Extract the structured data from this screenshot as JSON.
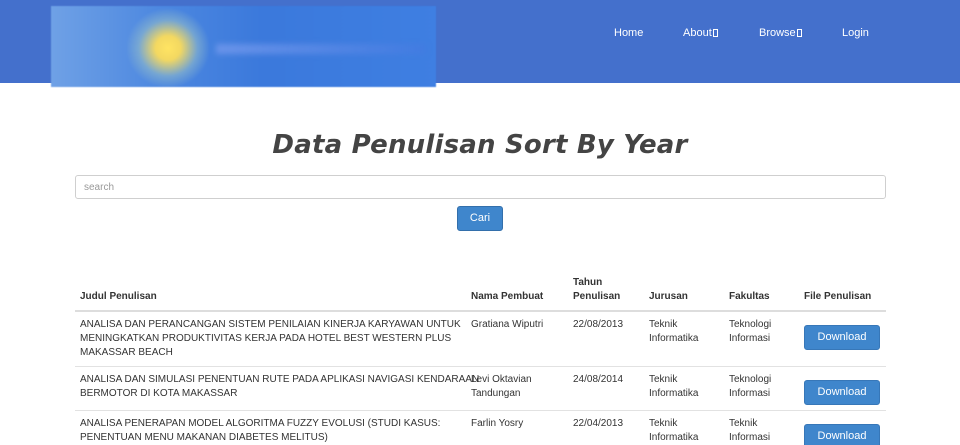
{
  "nav": {
    "home": "Home",
    "about": "About",
    "browse": "Browse",
    "login": "Login"
  },
  "page": {
    "title": "Data Penulisan Sort By Year"
  },
  "search": {
    "placeholder": "search",
    "button": "Cari"
  },
  "table": {
    "headers": {
      "judul": "Judul Penulisan",
      "nama": "Nama Pembuat",
      "tahun_1": "Tahun",
      "tahun_2": "Penulisan",
      "jurusan": "Jurusan",
      "fakultas": "Fakultas",
      "file": "File Penulisan"
    },
    "rows": [
      {
        "judul_lines": [
          "ANALISA DAN PERANCANGAN SISTEM PENILAIAN KINERJA KARYAWAN UNTUK",
          "MENINGKATKAN PRODUKTIVITAS KERJA PADA HOTEL BEST WESTERN PLUS",
          "MAKASSAR BEACH"
        ],
        "nama_lines": [
          "Gratiana Wiputri"
        ],
        "tahun": "22/08/2013",
        "jurusan_lines": [
          "Teknik",
          "Informatika"
        ],
        "fakultas_lines": [
          "Teknologi",
          "Informasi"
        ],
        "button": "Download"
      },
      {
        "judul_lines": [
          "ANALISA DAN SIMULASI PENENTUAN RUTE PADA APLIKASI NAVIGASI KENDARAAN",
          "BERMOTOR DI KOTA MAKASSAR"
        ],
        "nama_lines": [
          "Levi Oktavian",
          "Tandungan"
        ],
        "tahun": "24/08/2014",
        "jurusan_lines": [
          "Teknik",
          "Informatika"
        ],
        "fakultas_lines": [
          "Teknologi",
          "Informasi"
        ],
        "button": "Download"
      },
      {
        "judul_lines": [
          "ANALISA PENERAPAN MODEL ALGORITMA FUZZY EVOLUSI (STUDI KASUS:",
          "PENENTUAN MENU MAKANAN DIABETES MELITUS)"
        ],
        "nama_lines": [
          "Farlin Yosry"
        ],
        "tahun": "22/04/2013",
        "jurusan_lines": [
          "Teknik",
          "Informatika"
        ],
        "fakultas_lines": [
          "Teknik",
          "Informasi"
        ],
        "button": "Download"
      }
    ]
  }
}
